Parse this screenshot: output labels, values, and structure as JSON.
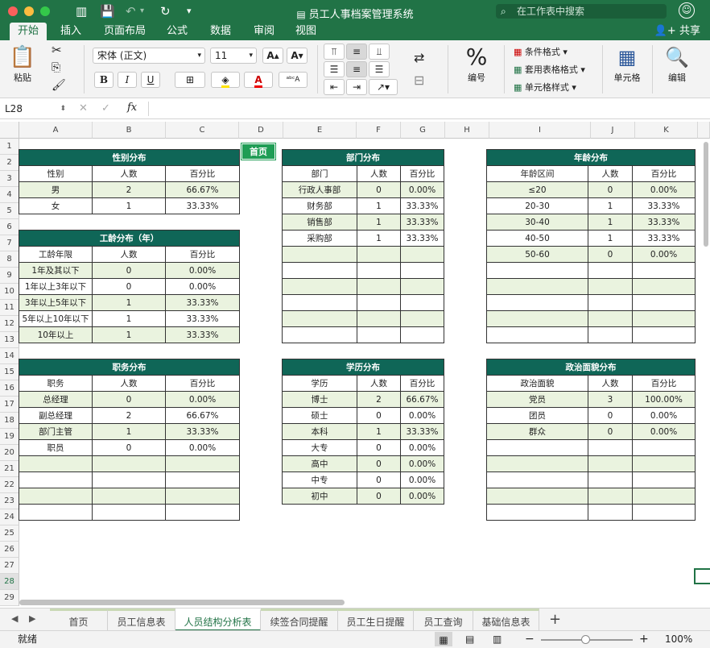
{
  "app": {
    "title": "员工人事档案管理系统",
    "search_placeholder": "在工作表中搜索",
    "share_label": "共享"
  },
  "tabs": [
    "开始",
    "插入",
    "页面布局",
    "公式",
    "数据",
    "审阅",
    "视图"
  ],
  "ribbon": {
    "paste_label": "粘贴",
    "font_name": "宋体 (正文)",
    "font_size": "11",
    "bold": "B",
    "italic": "I",
    "underline": "U",
    "number_label": "编号",
    "cond_format": "条件格式",
    "table_format": "套用表格格式",
    "cell_style": "单元格样式",
    "cells_label": "单元格",
    "edit_label": "编辑"
  },
  "formula_bar": {
    "cell_ref": "L28",
    "fx": "fx",
    "value": ""
  },
  "columns": [
    "A",
    "B",
    "C",
    "D",
    "E",
    "F",
    "G",
    "H",
    "I",
    "J",
    "K"
  ],
  "rows": [
    "1",
    "2",
    "3",
    "4",
    "5",
    "6",
    "7",
    "8",
    "9",
    "10",
    "11",
    "12",
    "13",
    "14",
    "15",
    "16",
    "17",
    "18",
    "19",
    "20",
    "21",
    "22",
    "23",
    "24",
    "25",
    "26",
    "27",
    "28",
    "29"
  ],
  "home_button": "首页",
  "tables": {
    "gender": {
      "title": "性别分布",
      "headers": [
        "性别",
        "人数",
        "百分比"
      ],
      "rows": [
        [
          "男",
          "2",
          "66.67%"
        ],
        [
          "女",
          "1",
          "33.33%"
        ]
      ]
    },
    "tenure": {
      "title": "工龄分布（年）",
      "headers": [
        "工龄年限",
        "人数",
        "百分比"
      ],
      "rows": [
        [
          "1年及其以下",
          "0",
          "0.00%"
        ],
        [
          "1年以上3年以下",
          "0",
          "0.00%"
        ],
        [
          "3年以上5年以下",
          "1",
          "33.33%"
        ],
        [
          "5年以上10年以下",
          "1",
          "33.33%"
        ],
        [
          "10年以上",
          "1",
          "33.33%"
        ]
      ]
    },
    "position": {
      "title": "职务分布",
      "headers": [
        "职务",
        "人数",
        "百分比"
      ],
      "rows": [
        [
          "总经理",
          "0",
          "0.00%"
        ],
        [
          "副总经理",
          "2",
          "66.67%"
        ],
        [
          "部门主管",
          "1",
          "33.33%"
        ],
        [
          "职员",
          "0",
          "0.00%"
        ],
        [
          "",
          "",
          ""
        ],
        [
          "",
          "",
          ""
        ],
        [
          "",
          "",
          ""
        ],
        [
          "",
          "",
          ""
        ]
      ]
    },
    "department": {
      "title": "部门分布",
      "headers": [
        "部门",
        "人数",
        "百分比"
      ],
      "rows": [
        [
          "行政人事部",
          "0",
          "0.00%"
        ],
        [
          "财务部",
          "1",
          "33.33%"
        ],
        [
          "销售部",
          "1",
          "33.33%"
        ],
        [
          "采购部",
          "1",
          "33.33%"
        ],
        [
          "",
          "",
          ""
        ],
        [
          "",
          "",
          ""
        ],
        [
          "",
          "",
          ""
        ],
        [
          "",
          "",
          ""
        ],
        [
          "",
          "",
          ""
        ],
        [
          "",
          "",
          ""
        ]
      ]
    },
    "education": {
      "title": "学历分布",
      "headers": [
        "学历",
        "人数",
        "百分比"
      ],
      "rows": [
        [
          "博士",
          "2",
          "66.67%"
        ],
        [
          "硕士",
          "0",
          "0.00%"
        ],
        [
          "本科",
          "1",
          "33.33%"
        ],
        [
          "大专",
          "0",
          "0.00%"
        ],
        [
          "高中",
          "0",
          "0.00%"
        ],
        [
          "中专",
          "0",
          "0.00%"
        ],
        [
          "初中",
          "0",
          "0.00%"
        ]
      ]
    },
    "age": {
      "title": "年龄分布",
      "headers": [
        "年龄区间",
        "人数",
        "百分比"
      ],
      "rows": [
        [
          "≤20",
          "0",
          "0.00%"
        ],
        [
          "20-30",
          "1",
          "33.33%"
        ],
        [
          "30-40",
          "1",
          "33.33%"
        ],
        [
          "40-50",
          "1",
          "33.33%"
        ],
        [
          "50-60",
          "0",
          "0.00%"
        ],
        [
          "",
          "",
          ""
        ],
        [
          "",
          "",
          ""
        ],
        [
          "",
          "",
          ""
        ],
        [
          "",
          "",
          ""
        ],
        [
          "",
          "",
          ""
        ]
      ]
    },
    "political": {
      "title": "政治面貌分布",
      "headers": [
        "政治面貌",
        "人数",
        "百分比"
      ],
      "rows": [
        [
          "党员",
          "3",
          "100.00%"
        ],
        [
          "团员",
          "0",
          "0.00%"
        ],
        [
          "群众",
          "0",
          "0.00%"
        ],
        [
          "",
          "",
          ""
        ],
        [
          "",
          "",
          ""
        ],
        [
          "",
          "",
          ""
        ],
        [
          "",
          "",
          ""
        ],
        [
          "",
          "",
          ""
        ]
      ]
    }
  },
  "sheets": [
    "首页",
    "员工信息表",
    "人员结构分析表",
    "续签合同提醒",
    "员工生日提醒",
    "员工查询",
    "基础信息表"
  ],
  "active_sheet": "人员结构分析表",
  "status": {
    "text": "就绪",
    "zoom": "100%"
  },
  "colors": {
    "accent": "#217346",
    "table_header": "#0f6657",
    "row_fill": "#eaf3df",
    "home_button": "#1f9d55"
  }
}
